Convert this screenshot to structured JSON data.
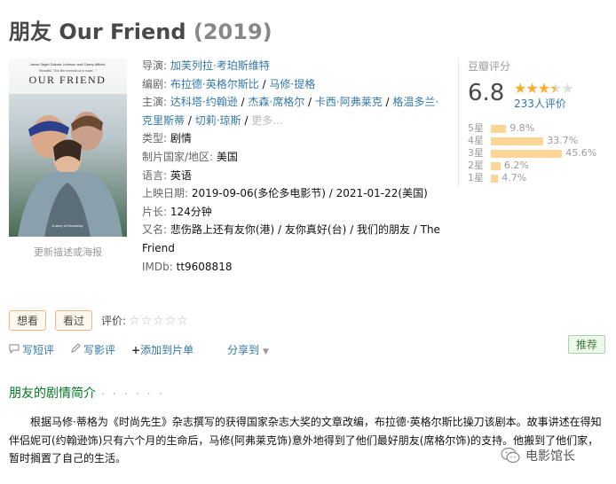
{
  "title": {
    "cn": "朋友",
    "en": "Our Friend",
    "year": "(2019)"
  },
  "poster": {
    "names": "Jason Segel     Dakota Johnson     and Casey Affleck",
    "quote": "\"Beautiful. This film reminds us to make...\"",
    "title_text": "OUR FRIEND",
    "caption": "A story of friendship",
    "link": "更新描述或海报"
  },
  "info": {
    "director_label": "导演",
    "director": "加芙列拉·考珀斯维特",
    "writer_label": "编剧",
    "writer1": "布拉德·英格尔斯比",
    "writer2": "马修·提格",
    "cast_label": "主演",
    "cast1": "达科塔·约翰逊",
    "cast2": "杰森·席格尔",
    "cast3": "卡西·阿弗莱克",
    "cast4": "格温多兰·克里斯蒂",
    "cast5": "切莉·琼斯",
    "cast_more": "更多...",
    "genre_label": "类型",
    "genre": "剧情",
    "country_label": "制片国家/地区",
    "country": "美国",
    "lang_label": "语言",
    "lang": "英语",
    "date_label": "上映日期",
    "date1": "2019-09-06(多伦多电影节)",
    "date2": "2021-01-22(美国)",
    "runtime_label": "片长",
    "runtime": "124分钟",
    "aka_label": "又名",
    "aka": "悲伤路上还有友你(港) / 友你真好(台) / 我们的朋友 / The Friend",
    "imdb_label": "IMDb",
    "imdb": "tt9608818"
  },
  "rating": {
    "label": "豆瓣评分",
    "score": "6.8",
    "stars_filled": 3.5,
    "votes": "233人评价",
    "accent": "#ffac2d",
    "dist": [
      {
        "label": "5星",
        "pct": "9.8%",
        "value": 9.8
      },
      {
        "label": "4星",
        "pct": "33.7%",
        "value": 33.7
      },
      {
        "label": "3星",
        "pct": "45.6%",
        "value": 45.6
      },
      {
        "label": "2星",
        "pct": "6.2%",
        "value": 6.2
      },
      {
        "label": "1星",
        "pct": "4.7%",
        "value": 4.7
      }
    ]
  },
  "actions": {
    "want": "想看",
    "seen": "看过",
    "rate_label": "评价:",
    "rate_stars": "☆☆☆☆☆"
  },
  "links": {
    "short_review": "写短评",
    "review": "写影评",
    "add_list": "添加到片单",
    "share": "分享到",
    "recommend": "推荐"
  },
  "icons": {
    "comment": "comment-icon",
    "pencil": "pencil-icon",
    "plus": "plus-icon",
    "dropdown": "triangle-down-icon"
  },
  "summary": {
    "title": "朋友的剧情简介",
    "dots": "· · · · · ·",
    "text": "根据马修·蒂格为《时尚先生》杂志撰写的获得国家杂志大奖的文章改编，布拉德·英格尔斯比操刀该剧本。故事讲述在得知伴侣妮可(约翰逊饰)只有六个月的生命后，马修(阿弗莱克饰)意外地得到了他们最好朋友(席格尔饰)的支持。他搬到了他们家，暂时搁置了自己的生活。"
  },
  "watermark": {
    "text": "电影馆长"
  }
}
